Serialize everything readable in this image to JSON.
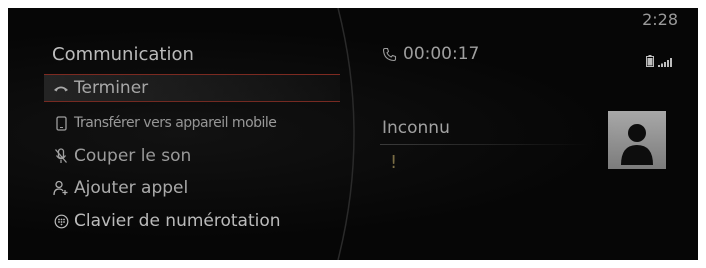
{
  "status_bar": {
    "time": "2:28",
    "battery_icon": "battery-icon",
    "signal_icon": "signal-icon"
  },
  "menu": {
    "title": "Communication",
    "items": [
      {
        "label": "Terminer",
        "icon": "hang-up-icon",
        "selected": true
      },
      {
        "label": "Transférer vers appareil mobile",
        "icon": "mobile-device-icon",
        "selected": false
      },
      {
        "label": "Couper le son",
        "icon": "mute-microphone-icon",
        "selected": false
      },
      {
        "label": "Ajouter appel",
        "icon": "add-call-icon",
        "selected": false
      },
      {
        "label": "Clavier de numérotation",
        "icon": "keypad-icon",
        "selected": false
      }
    ]
  },
  "call": {
    "phone_icon": "phone-icon",
    "duration": "00:00:17",
    "caller_name": "Inconnu",
    "caller_indicator": "!",
    "avatar_icon": "person-avatar-icon"
  },
  "colors": {
    "background": "#060606",
    "text": "#c4c4c4",
    "highlight_border": "#8a2a20"
  }
}
